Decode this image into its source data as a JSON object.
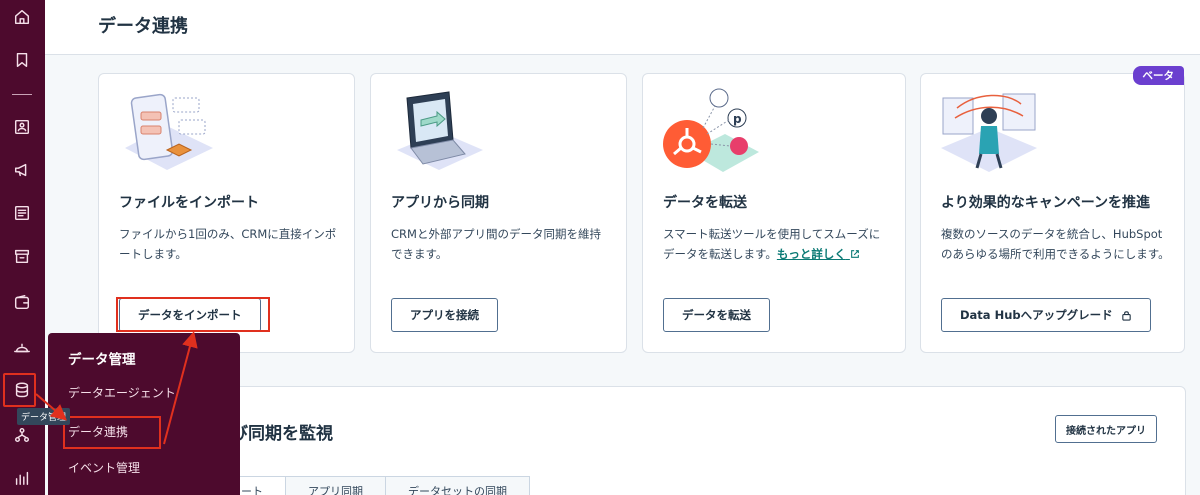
{
  "header": {
    "title": "データ連携"
  },
  "rail": {
    "icons": [
      "home-icon",
      "bookmark-icon",
      "contacts-icon",
      "megaphone-icon",
      "document-icon",
      "commerce-icon",
      "wallet-icon",
      "service-icon",
      "database-icon",
      "workflow-icon",
      "chart-icon"
    ],
    "tooltip": "データ管理"
  },
  "cards": [
    {
      "title": "ファイルをインポート",
      "desc": "ファイルから1回のみ、CRMに直接インポートします。",
      "button": "データをインポート"
    },
    {
      "title": "アプリから同期",
      "desc": "CRMと外部アプリ間のデータ同期を維持できます。",
      "button": "アプリを接続"
    },
    {
      "title": "データを転送",
      "desc": "スマート転送ツールを使用してスムーズにデータを転送します。",
      "link": "もっと詳しく",
      "button": "データを転送"
    },
    {
      "title": "より効果的なキャンペーンを推進",
      "desc": "複数のソースのデータを統合し、HubSpotのあらゆる場所で利用できるようにします。",
      "button": "Data Hubへアップグレード",
      "badge": "ベータ"
    }
  ],
  "panel": {
    "title": "び同期を監視",
    "button": "接続されたアプリ",
    "tabs": [
      "ート",
      "アプリ同期",
      "データセットの同期"
    ]
  },
  "flyout": {
    "title": "データ管理",
    "items": [
      "データエージェント",
      "データ連携",
      "イベント管理"
    ]
  },
  "colors": {
    "rail": "#4d0a2d",
    "annotation": "#e0301e",
    "beta": "#6b3fcf",
    "link": "#0b7a75"
  }
}
